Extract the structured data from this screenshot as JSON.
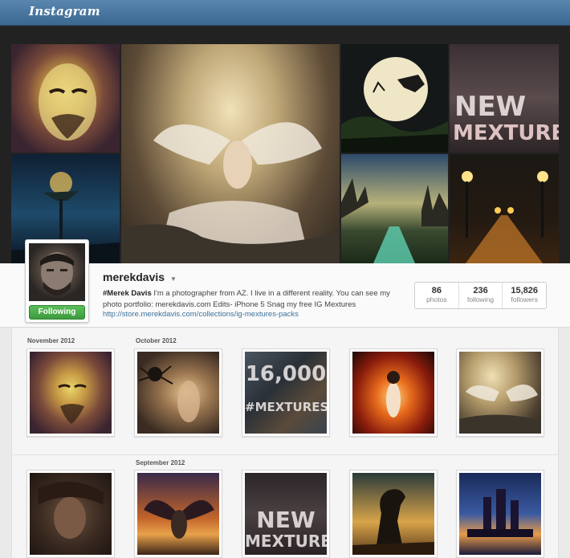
{
  "app": {
    "logo": "Instagram"
  },
  "hero": {
    "new_mextures_caption_line1": "NEW",
    "new_mextures_caption_line2": "MEXTURES"
  },
  "profile": {
    "username": "merekdavis",
    "bio_name": "#Merek Davis",
    "bio_text": " I'm a photographer from AZ. I live in a different reality. You can see my photo portfolio: merekdavis.com Edits- iPhone 5 Snag my free IG Mextures ",
    "link": "http://store.merekdavis.com/collections/ig-mextures-packs",
    "follow_label": "Following",
    "stats": [
      {
        "value": "86",
        "label": "photos"
      },
      {
        "value": "236",
        "label": "following"
      },
      {
        "value": "15,826",
        "label": "followers"
      }
    ]
  },
  "grid": {
    "months": [
      "November 2012",
      "October 2012",
      "September 2012"
    ],
    "caption_16000_line1": "16,000",
    "caption_16000_line2": "#MEXTURES",
    "caption_new_line1": "NEW",
    "caption_new_line2": "MEXTURES"
  }
}
